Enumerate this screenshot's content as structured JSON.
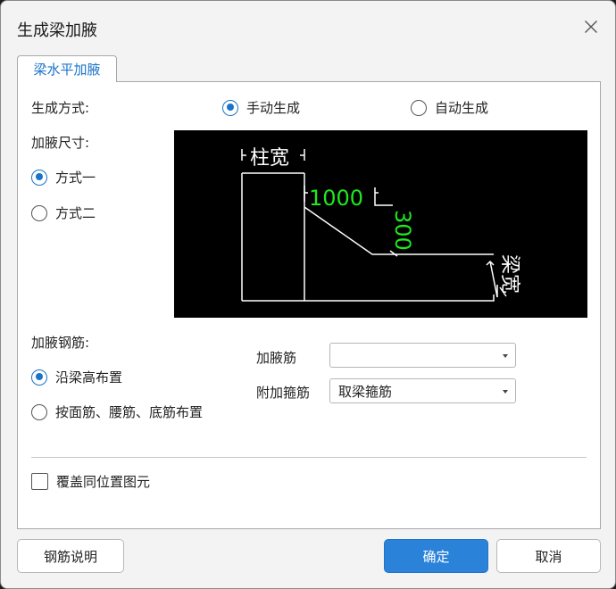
{
  "window": {
    "title": "生成梁加腋"
  },
  "tab": {
    "label": "梁水平加腋"
  },
  "generate": {
    "label": "生成方式:",
    "options": [
      {
        "label": "手动生成",
        "selected": true
      },
      {
        "label": "自动生成",
        "selected": false
      }
    ]
  },
  "size": {
    "label": "加腋尺寸:",
    "options": [
      {
        "label": "方式一",
        "selected": true
      },
      {
        "label": "方式二",
        "selected": false
      }
    ]
  },
  "diagram": {
    "column_width_label": "柱宽",
    "length_value": "1000",
    "height_value": "300",
    "beam_width_label": "梁宽",
    "value_color": "#1ee81e"
  },
  "rebar": {
    "label": "加腋钢筋:",
    "options": [
      {
        "label": "沿梁高布置",
        "selected": true
      },
      {
        "label": "按面筋、腰筋、底筋布置",
        "selected": false
      }
    ]
  },
  "haunch_bar": {
    "label": "加腋筋",
    "value": ""
  },
  "stirrup": {
    "label": "附加箍筋",
    "value": "取梁箍筋"
  },
  "overwrite": {
    "label": "覆盖同位置图元",
    "checked": false
  },
  "buttons": {
    "help": "钢筋说明",
    "ok": "确定",
    "cancel": "取消"
  },
  "colors": {
    "accent": "#1a73c8",
    "primary_button": "#2b82d9"
  }
}
